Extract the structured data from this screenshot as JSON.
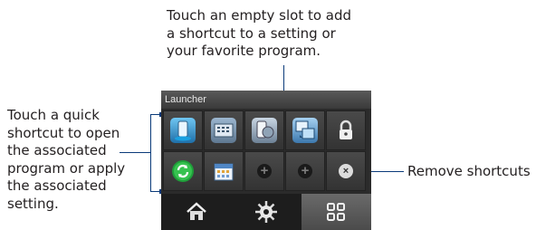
{
  "callouts": {
    "top": [
      "Touch an empty slot to add",
      "a shortcut to a setting or",
      "your favorite program."
    ],
    "left": [
      "Touch a quick",
      "shortcut to open",
      "the associated",
      "program or apply",
      "the associated",
      "setting."
    ],
    "right": "Remove shortcuts"
  },
  "app": {
    "title": "Launcher"
  },
  "colors": {
    "leader_line": "#0b3b7a",
    "tab_selected": "#5a5a5a"
  },
  "grid": {
    "rows": [
      [
        {
          "icon": "phone-signal-icon",
          "glyph": "📱",
          "kind": "shortcut"
        },
        {
          "icon": "keyboard-settings-icon",
          "glyph": "▦",
          "kind": "shortcut"
        },
        {
          "icon": "media-settings-icon",
          "glyph": "◐",
          "kind": "shortcut"
        },
        {
          "icon": "windows-sync-icon",
          "glyph": "⧉",
          "kind": "shortcut"
        },
        {
          "icon": "lock-icon",
          "glyph": "🔒",
          "kind": "shortcut"
        }
      ],
      [
        {
          "icon": "refresh-sync-icon",
          "glyph": "⟳",
          "kind": "shortcut"
        },
        {
          "icon": "calendar-icon",
          "glyph": "▦",
          "kind": "shortcut"
        },
        {
          "icon": "add-icon",
          "glyph": "+",
          "kind": "empty"
        },
        {
          "icon": "add-icon",
          "glyph": "+",
          "kind": "empty"
        },
        {
          "icon": "remove-icon",
          "glyph": "×",
          "kind": "remove"
        }
      ]
    ]
  },
  "tabs": [
    {
      "icon": "home-icon",
      "glyph": "⌂",
      "selected": false
    },
    {
      "icon": "settings-gear-icon",
      "glyph": "✹",
      "selected": false
    },
    {
      "icon": "launcher-grid-icon",
      "glyph": "⊞",
      "selected": true
    }
  ]
}
